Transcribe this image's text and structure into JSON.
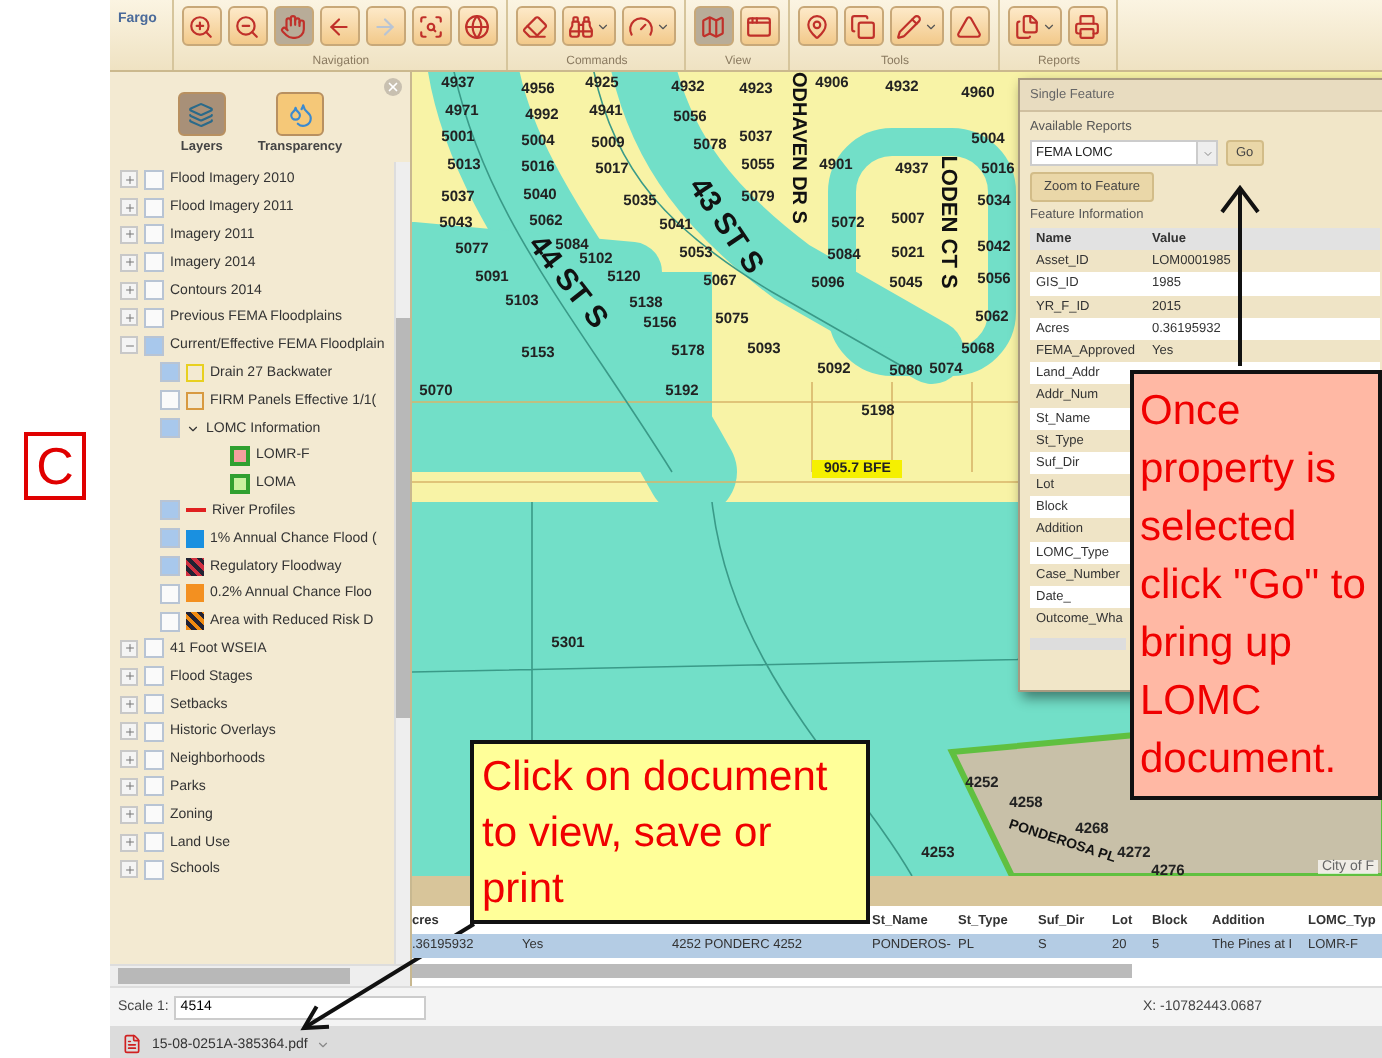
{
  "page_marker": "C",
  "toolbar": {
    "title": "Fargo",
    "groups": [
      {
        "label": "Navigation",
        "buttons": [
          {
            "kind": "zoom-in",
            "selected": false,
            "disabled": false,
            "menu": false
          },
          {
            "kind": "zoom-out",
            "selected": false,
            "disabled": false,
            "menu": false
          },
          {
            "kind": "pan",
            "selected": true,
            "disabled": false,
            "menu": false
          },
          {
            "kind": "back",
            "selected": false,
            "disabled": false,
            "menu": false
          },
          {
            "kind": "forward",
            "selected": false,
            "disabled": true,
            "menu": false
          },
          {
            "kind": "zoom-extent",
            "selected": false,
            "disabled": false,
            "menu": false
          },
          {
            "kind": "globe",
            "selected": false,
            "disabled": false,
            "menu": false
          }
        ]
      },
      {
        "label": "Commands",
        "buttons": [
          {
            "kind": "eraser",
            "selected": false,
            "disabled": false,
            "menu": false
          },
          {
            "kind": "binoculars",
            "selected": false,
            "disabled": false,
            "menu": true
          },
          {
            "kind": "gauge",
            "selected": false,
            "disabled": false,
            "menu": true
          }
        ]
      },
      {
        "label": "View",
        "buttons": [
          {
            "kind": "map",
            "selected": true,
            "disabled": false,
            "menu": false
          },
          {
            "kind": "window",
            "selected": false,
            "disabled": false,
            "menu": false
          }
        ]
      },
      {
        "label": "Tools",
        "buttons": [
          {
            "kind": "pin",
            "selected": false,
            "disabled": false,
            "menu": false
          },
          {
            "kind": "copy",
            "selected": false,
            "disabled": false,
            "menu": false
          },
          {
            "kind": "pencil",
            "selected": false,
            "disabled": false,
            "menu": true
          },
          {
            "kind": "triangle",
            "selected": false,
            "disabled": false,
            "menu": false
          }
        ]
      },
      {
        "label": "Reports",
        "buttons": [
          {
            "kind": "documents",
            "selected": false,
            "disabled": false,
            "menu": true
          },
          {
            "kind": "printer",
            "selected": false,
            "disabled": false,
            "menu": false
          }
        ]
      }
    ]
  },
  "panel": {
    "buttons": [
      {
        "kind": "layers",
        "label": "Layers"
      },
      {
        "kind": "transparency",
        "label": "Transparency"
      }
    ],
    "layers": [
      {
        "kind": "group",
        "label": "Flood Imagery 2010",
        "checked": false,
        "expanded": false
      },
      {
        "kind": "group",
        "label": "Flood Imagery 2011",
        "checked": false,
        "expanded": false
      },
      {
        "kind": "group",
        "label": "Imagery 2011",
        "checked": false,
        "expanded": false
      },
      {
        "kind": "group",
        "label": "Imagery 2014",
        "checked": false,
        "expanded": false
      },
      {
        "kind": "group",
        "label": "Contours 2014",
        "checked": false,
        "expanded": false
      },
      {
        "kind": "group",
        "label": "Previous FEMA Floodplains",
        "checked": false,
        "expanded": false
      },
      {
        "kind": "group",
        "label": "Current/Effective FEMA Floodplain",
        "checked": true,
        "expanded": true,
        "children": [
          {
            "kind": "layer",
            "label": "Drain 27 Backwater",
            "checked": true,
            "symbol": {
              "kind": "outline",
              "color": "#e8d020"
            }
          },
          {
            "kind": "layer",
            "label": "FIRM Panels Effective 1/1(",
            "checked": false,
            "symbol": {
              "kind": "outline",
              "color": "#d89a40"
            }
          },
          {
            "kind": "folder",
            "label": "LOMC Information",
            "checked": true,
            "expanded": true,
            "children": [
              {
                "kind": "legend",
                "label": "LOMR-F",
                "symbol": {
                  "kind": "outline-fill",
                  "color": "#f4a0a0"
                }
              },
              {
                "kind": "legend",
                "label": "LOMA",
                "symbol": {
                  "kind": "outline-fill",
                  "color": "#c8f0a0"
                }
              }
            ]
          },
          {
            "kind": "layer",
            "label": "River Profiles",
            "checked": true,
            "symbol": {
              "kind": "line",
              "color": "#e02020"
            }
          },
          {
            "kind": "layer",
            "label": "1% Annual Chance Flood (",
            "checked": true,
            "symbol": {
              "kind": "fill",
              "color": "#1a90e0"
            }
          },
          {
            "kind": "layer",
            "label": "Regulatory Floodway",
            "checked": true,
            "symbol": {
              "kind": "hatch",
              "color": "#d03040"
            }
          },
          {
            "kind": "layer",
            "label": "0.2% Annual Chance Floo",
            "checked": false,
            "symbol": {
              "kind": "fill",
              "color": "#f39020"
            }
          },
          {
            "kind": "layer",
            "label": "Area with Reduced Risk D",
            "checked": false,
            "symbol": {
              "kind": "hatch",
              "color": "#f08a10"
            }
          }
        ]
      },
      {
        "kind": "group",
        "label": "41 Foot WSEIA",
        "checked": false,
        "expanded": false
      },
      {
        "kind": "group",
        "label": "Flood Stages",
        "checked": false,
        "expanded": false
      },
      {
        "kind": "group",
        "label": "Setbacks",
        "checked": false,
        "expanded": false
      },
      {
        "kind": "group",
        "label": "Historic Overlays",
        "checked": false,
        "expanded": false
      },
      {
        "kind": "group",
        "label": "Neighborhoods",
        "checked": false,
        "expanded": false
      },
      {
        "kind": "group",
        "label": "Parks",
        "checked": false,
        "expanded": false
      },
      {
        "kind": "group",
        "label": "Zoning",
        "checked": false,
        "expanded": false
      },
      {
        "kind": "group",
        "label": "Land Use",
        "checked": false,
        "expanded": false
      },
      {
        "kind": "group",
        "label": "Schools",
        "checked": false,
        "expanded": false
      }
    ]
  },
  "map": {
    "parcels": [
      "4937",
      "4956",
      "4925",
      "4932",
      "4923",
      "4906",
      "4932",
      "4960",
      "4971",
      "4992",
      "4941",
      "5056",
      "5001",
      "5004",
      "5009",
      "5078",
      "5037",
      "5004",
      "5013",
      "5016",
      "5017",
      "5055",
      "4901",
      "4937",
      "5016",
      "5037",
      "5040",
      "5035",
      "5079",
      "5034",
      "5043",
      "5062",
      "5041",
      "5072",
      "5007",
      "5077",
      "5084",
      "5102",
      "5053",
      "5084",
      "5021",
      "5042",
      "5091",
      "5120",
      "5067",
      "5096",
      "5045",
      "5056",
      "5103",
      "5138",
      "5156",
      "5075",
      "5062",
      "5153",
      "5178",
      "5093",
      "5068",
      "5092",
      "5080",
      "5074",
      "5070",
      "5192",
      "5198",
      "5301",
      "4252",
      "4258",
      "4268",
      "4253",
      "4272",
      "4276"
    ],
    "streets": [
      "44 ST S",
      "43 ST S",
      "ODHAVEN DR S",
      "LODEN CT S",
      "PONDEROSA PL"
    ],
    "flood_label": "905.7 BFE",
    "credit": "City of F"
  },
  "feature_panel": {
    "title": "Single Feature",
    "reports_label": "Available Reports",
    "report_select": "FEMA LOMC",
    "go_button": "Go",
    "zoom_button": "Zoom to Feature",
    "info_label": "Feature Information",
    "columns": [
      "Name",
      "Value"
    ],
    "rows": [
      {
        "name": "Asset_ID",
        "value": "LOM0001985"
      },
      {
        "name": "GIS_ID",
        "value": "1985"
      },
      {
        "name": "YR_F_ID",
        "value": "2015"
      },
      {
        "name": "Acres",
        "value": "0.36195932"
      },
      {
        "name": "FEMA_Approved",
        "value": "Yes"
      },
      {
        "name": "Land_Addr"
      },
      {
        "name": "Addr_Num"
      },
      {
        "name": "St_Name"
      },
      {
        "name": "St_Type"
      },
      {
        "name": "Suf_Dir"
      },
      {
        "name": "Lot"
      },
      {
        "name": "Block"
      },
      {
        "name": "Addition"
      },
      {
        "name": "LOMC_Type"
      },
      {
        "name": "Case_Number"
      },
      {
        "name": "Date_"
      },
      {
        "name": "Outcome_Wha"
      }
    ]
  },
  "attribute_table": {
    "headers": [
      "cres",
      "St_Name",
      "St_Type",
      "Suf_Dir",
      "Lot",
      "Block",
      "Addition",
      "LOMC_Typ"
    ],
    "rows": [
      {
        "selected": true,
        "cells": [
          ".36195932",
          "Yes",
          "4252 PONDERC 4252",
          "PONDEROS-",
          "PL",
          "S",
          "20",
          "5",
          "The Pines at I",
          "LOMR-F"
        ]
      }
    ]
  },
  "status_bar": {
    "scale_label": "Scale 1:",
    "scale_value": "4514",
    "coords": "X: -10782443.0687"
  },
  "download_bar": {
    "file": "15-08-0251A-385364.pdf"
  },
  "callouts": [
    {
      "kind": "go",
      "text": "Once property is selected click \"Go\" to bring up LOMC document."
    },
    {
      "kind": "document",
      "text": "Click on document to view, save or print"
    }
  ]
}
